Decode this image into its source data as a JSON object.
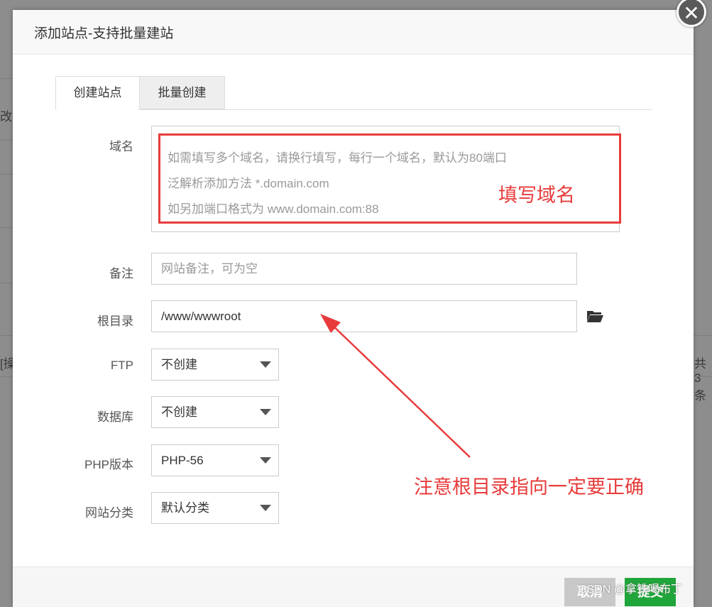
{
  "background": {
    "left_fragment": "改",
    "left_fragment2": "[操",
    "right_fragment": "共3条"
  },
  "dialog": {
    "title": "添加站点-支持批量建站",
    "close_symbol": "✕"
  },
  "tabs": [
    {
      "label": "创建站点",
      "active": true
    },
    {
      "label": "批量创建",
      "active": false
    }
  ],
  "form": {
    "domain": {
      "label": "域名",
      "placeholder_lines": [
        "如需填写多个域名，请换行填写，每行一个域名，默认为80端口",
        "泛解析添加方法 *.domain.com",
        "如另加端口格式为 www.domain.com:88"
      ]
    },
    "remark": {
      "label": "备注",
      "placeholder": "网站备注，可为空"
    },
    "root_dir": {
      "label": "根目录",
      "value": "/www/wwwroot",
      "icon": "folder-open-icon"
    },
    "ftp": {
      "label": "FTP",
      "selected": "不创建"
    },
    "database": {
      "label": "数据库",
      "selected": "不创建"
    },
    "php_version": {
      "label": "PHP版本",
      "selected": "PHP-56"
    },
    "site_category": {
      "label": "网站分类",
      "selected": "默认分类"
    }
  },
  "annotations": {
    "domain_note": "填写域名",
    "root_note": "注意根目录指向一定要正确",
    "color": "#e83b3b"
  },
  "footer": {
    "cancel_label": "取消",
    "submit_label": "提交",
    "submit_color": "#20a53a"
  },
  "watermark": "CSDN @拿铁喝布丁"
}
